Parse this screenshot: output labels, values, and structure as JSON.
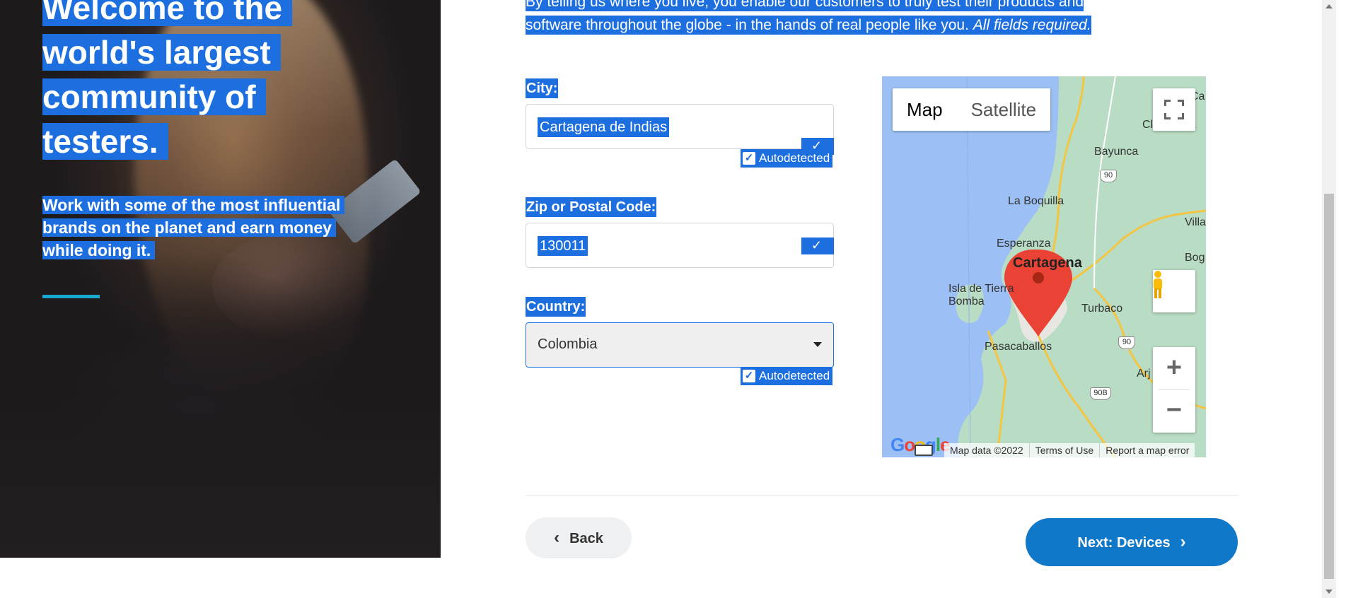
{
  "hero": {
    "title_lines": [
      "Welcome to the",
      "world's largest",
      "community of",
      "testers."
    ],
    "subtitle_lines": [
      "Work with some of the most influential",
      "brands on the planet and earn money",
      "while doing it."
    ]
  },
  "intro": {
    "line1": "By telling us where you live, you enable our customers to truly test their products and",
    "line2": "software throughout the globe - in the hands of real people like you.",
    "required": "All fields required."
  },
  "form": {
    "city": {
      "label": "City:",
      "value": "Cartagena de Indias",
      "badge": "Autodetected"
    },
    "zip": {
      "label": "Zip or Postal Code:",
      "value": "130011"
    },
    "country": {
      "label": "Country:",
      "value": "Colombia",
      "badge": "Autodetected"
    }
  },
  "map": {
    "type_map": "Map",
    "type_satellite": "Satellite",
    "zoom_in": "+",
    "zoom_out": "−",
    "footer": {
      "data": "Map data ©2022",
      "terms": "Terms of Use",
      "report": "Report a map error"
    },
    "logo": "Google",
    "labels": [
      "Cartagena",
      "Bayunca",
      "La Boquilla",
      "Turbaco",
      "Pasacaballos",
      "Isla de Tierra Bomba",
      "Esperanza",
      "Clemencia",
      "Villa",
      "Bog",
      "Arj",
      "Ca"
    ],
    "highway_shields": [
      "90",
      "90",
      "90B"
    ]
  },
  "nav": {
    "back": "Back",
    "next": "Next: Devices"
  },
  "colors": {
    "selection": "#1d6fe0",
    "next_button": "#0f78c8",
    "accent_rule": "#18a9cf"
  }
}
